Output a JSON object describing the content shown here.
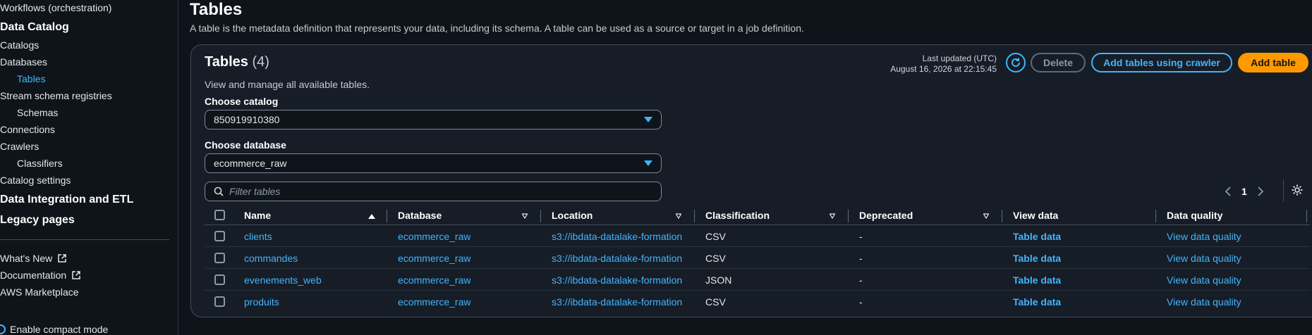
{
  "sidebar": {
    "workflows": "Workflows (orchestration)",
    "data_catalog": "Data Catalog",
    "catalogs": "Catalogs",
    "databases": "Databases",
    "tables": "Tables",
    "stream_schema_registries": "Stream schema registries",
    "schemas": "Schemas",
    "connections": "Connections",
    "crawlers": "Crawlers",
    "classifiers": "Classifiers",
    "catalog_settings": "Catalog settings",
    "data_integration": "Data Integration and ETL",
    "legacy_pages": "Legacy pages",
    "whats_new": "What's New",
    "documentation": "Documentation",
    "aws_marketplace": "AWS Marketplace",
    "compact_mode": "Enable compact mode"
  },
  "page": {
    "title": "Tables",
    "description": "A table is the metadata definition that represents your data, including its schema. A table can be used as a source or target in a job definition."
  },
  "panel": {
    "title": "Tables",
    "count": "(4)",
    "subtitle": "View and manage all available tables.",
    "last_updated_label": "Last updated (UTC)",
    "last_updated_value": "August 16, 2026 at 22:15:45",
    "delete_label": "Delete",
    "crawler_label": "Add tables using crawler",
    "add_table_label": "Add table",
    "catalog_label": "Choose catalog",
    "catalog_value": "850919910380",
    "database_label": "Choose database",
    "database_value": "ecommerce_raw",
    "search_placeholder": "Filter tables",
    "page_number": "1"
  },
  "table": {
    "columns": [
      "Name",
      "Database",
      "Location",
      "Classification",
      "Deprecated",
      "View data",
      "Data quality"
    ],
    "rows": [
      {
        "name": "clients",
        "database": "ecommerce_raw",
        "location": "s3://ibdata-datalake-formation",
        "classification": "CSV",
        "deprecated": "-",
        "view_data": "Table data",
        "data_quality": "View data quality"
      },
      {
        "name": "commandes",
        "database": "ecommerce_raw",
        "location": "s3://ibdata-datalake-formation",
        "classification": "CSV",
        "deprecated": "-",
        "view_data": "Table data",
        "data_quality": "View data quality"
      },
      {
        "name": "evenements_web",
        "database": "ecommerce_raw",
        "location": "s3://ibdata-datalake-formation",
        "classification": "JSON",
        "deprecated": "-",
        "view_data": "Table data",
        "data_quality": "View data quality"
      },
      {
        "name": "produits",
        "database": "ecommerce_raw",
        "location": "s3://ibdata-datalake-formation",
        "classification": "CSV",
        "deprecated": "-",
        "view_data": "Table data",
        "data_quality": "View data quality"
      }
    ]
  },
  "colors": {
    "accent": "#42b4ff",
    "primary_button": "#ff9900",
    "background": "#0f141a",
    "panel": "#161d26"
  }
}
